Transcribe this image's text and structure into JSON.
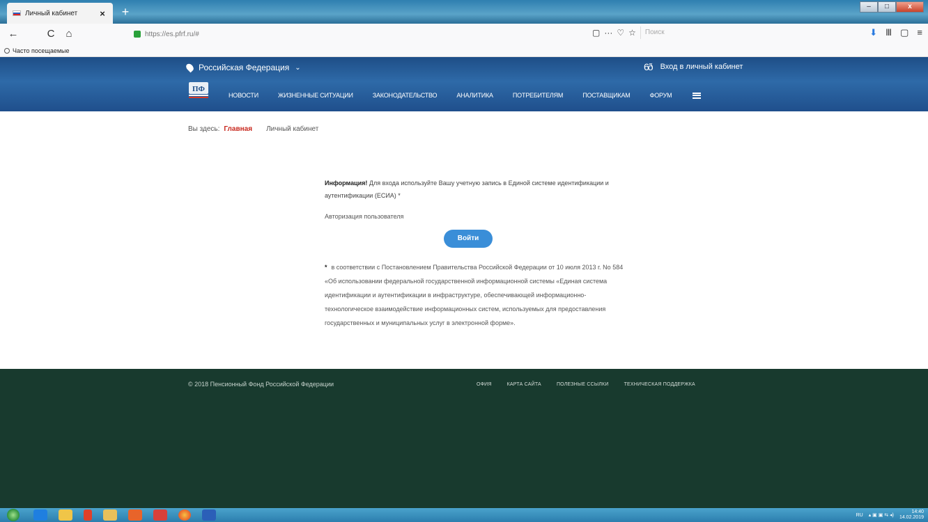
{
  "browser": {
    "tab_title": "Личный кабинет",
    "tab_close": "×",
    "new_tab": "+",
    "back": "←",
    "reload": "C",
    "home": "⌂",
    "url": "https://es.pfrf.ru/#",
    "url_menu": "···",
    "bookmark_star": "☆",
    "search_placeholder": "Поиск",
    "bookmarks_bar": "Часто посещаемые",
    "window_min": "–",
    "window_max": "□",
    "window_close": "x"
  },
  "site": {
    "region": "Российская Федерация",
    "login_link": "Вход в личный кабинет",
    "nav": [
      "НОВОСТИ",
      "ЖИЗНЕННЫЕ СИТУАЦИИ",
      "ЗАКОНОДАТЕЛЬСТВО",
      "АНАЛИТИКА",
      "ПОТРЕБИТЕЛЯМ",
      "ПОСТАВЩИКАМ",
      "ФОРУМ"
    ],
    "logo_alt": "ПФР"
  },
  "breadcrumb": {
    "prefix": "Вы здесь:",
    "home": "Главная",
    "current": "Личный кабинет"
  },
  "content": {
    "info_label": "Информация!",
    "info_text": "Для входа используйте Вашу учетную запись в Единой системе идентификации и аутентификации (ЕСИА) *",
    "auth_label": "Авторизация пользователя",
    "login_button": "Войти",
    "footnote_star": "*",
    "footnote": "в соответствии с Постановлением Правительства Российской Федерации от 10 июля 2013 г. No 584 «Об использовании федеральной государственной информационной системы «Единая система идентификации и аутентификации в инфраструктуре, обеспечивающей информационно-технологическое взаимодействие информационных систем, используемых для предоставления государственных и муниципальных услуг в электронной форме»."
  },
  "footer": {
    "copyright": "© 2018 Пенсионный Фонд Российской Федерации",
    "links": [
      "ОФИЯ",
      "КАРТА САЙТА",
      "ПОЛЕЗНЫЕ ССЫЛКИ",
      "ТЕХНИЧЕСКАЯ ПОДДЕРЖКА"
    ]
  },
  "taskbar": {
    "lang": "RU",
    "time": "14:40",
    "date": "14.02.2019"
  }
}
